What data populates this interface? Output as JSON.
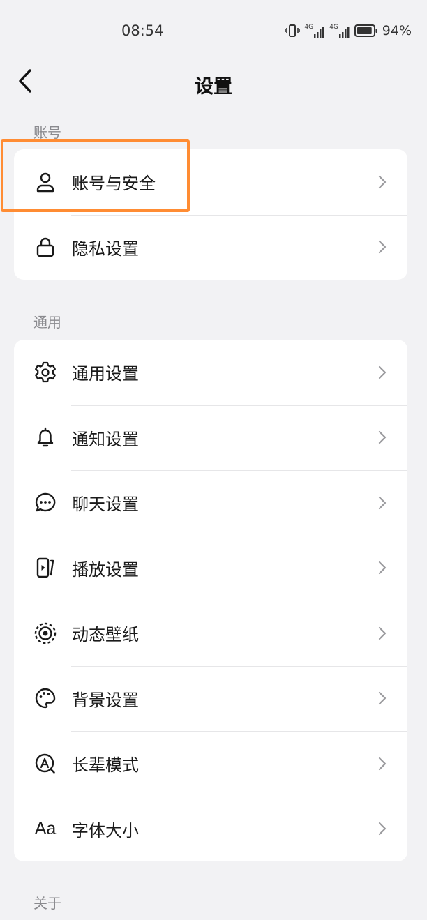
{
  "status_bar": {
    "time": "08:54",
    "signal_1": "4G",
    "signal_2": "4G",
    "battery": "94%",
    "battery_level": 0.94
  },
  "nav": {
    "title": "设置",
    "back_icon": "chevron-left-icon"
  },
  "sections": {
    "account": {
      "title": "账号",
      "items": [
        {
          "label": "账号与安全",
          "icon": "user-icon"
        },
        {
          "label": "隐私设置",
          "icon": "lock-icon"
        }
      ]
    },
    "general": {
      "title": "通用",
      "items": [
        {
          "label": "通用设置",
          "icon": "gear-icon"
        },
        {
          "label": "通知设置",
          "icon": "bell-icon"
        },
        {
          "label": "聊天设置",
          "icon": "chat-bubble-icon"
        },
        {
          "label": "播放设置",
          "icon": "play-phone-icon"
        },
        {
          "label": "动态壁纸",
          "icon": "live-wallpaper-icon"
        },
        {
          "label": "背景设置",
          "icon": "palette-icon"
        },
        {
          "label": "长辈模式",
          "icon": "elder-mode-icon"
        },
        {
          "label": "字体大小",
          "icon": "font-size-icon",
          "icon_text": "Aa"
        }
      ]
    },
    "about": {
      "title": "关于"
    }
  },
  "colors": {
    "background": "#f2f2f4",
    "card": "#ffffff",
    "highlight": "#ff8c33",
    "chevron": "#9a9a9e"
  }
}
